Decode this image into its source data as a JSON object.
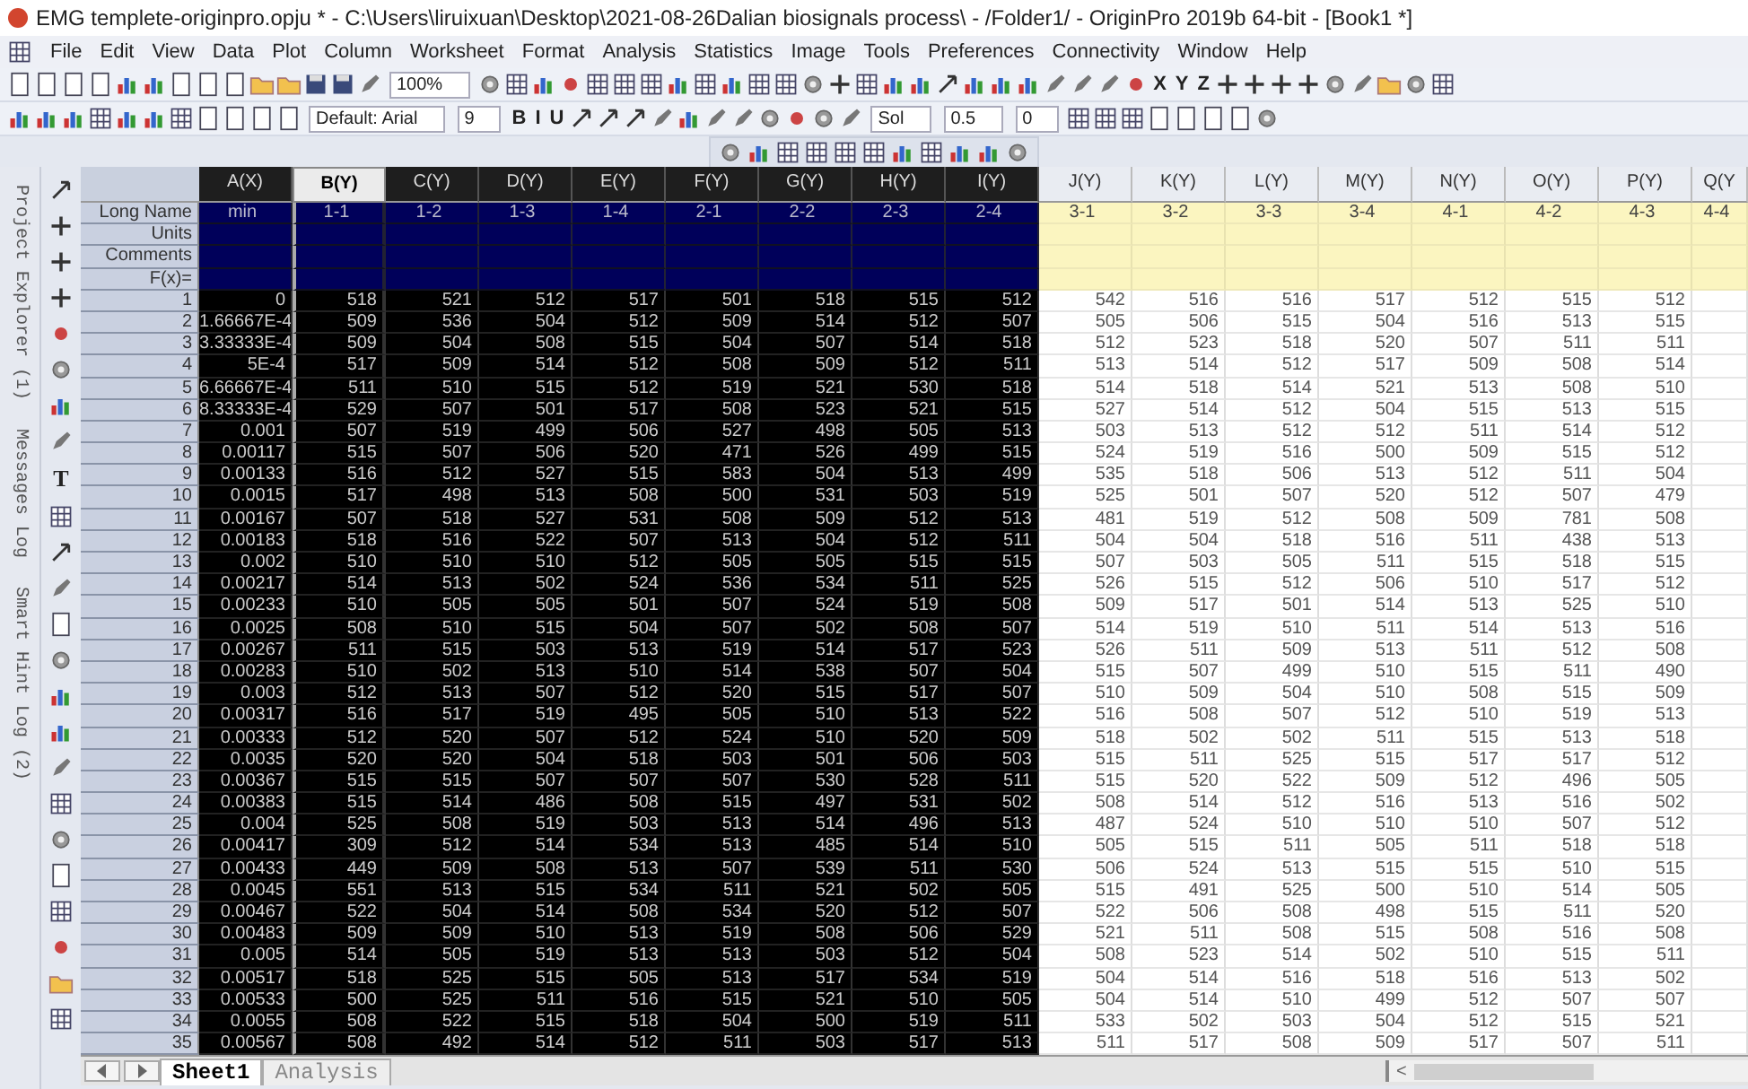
{
  "window": {
    "title": "EMG templete-originpro.opju * - C:\\Users\\liruixuan\\Desktop\\2021-08-26Dalian biosignals process\\ - /Folder1/ - OriginPro 2019b 64-bit - [Book1 *]"
  },
  "menu": [
    "File",
    "Edit",
    "View",
    "Data",
    "Plot",
    "Column",
    "Worksheet",
    "Format",
    "Analysis",
    "Statistics",
    "Image",
    "Tools",
    "Preferences",
    "Connectivity",
    "Window",
    "Help"
  ],
  "toolbar_1": [
    {
      "kind": "field",
      "value": "100%"
    },
    {
      "kind": "glyph",
      "text": "X"
    },
    {
      "kind": "glyph",
      "text": "Y"
    },
    {
      "kind": "glyph",
      "text": "Z"
    }
  ],
  "toolbar_2": [
    {
      "kind": "field",
      "value": "Default: Arial"
    },
    {
      "kind": "field",
      "value": "9"
    },
    {
      "kind": "glyph",
      "text": "B"
    },
    {
      "kind": "glyph",
      "text": "I"
    },
    {
      "kind": "glyph",
      "text": "U"
    },
    {
      "kind": "field",
      "value": "Sol"
    },
    {
      "kind": "field",
      "value": "0.5"
    },
    {
      "kind": "field",
      "value": "0"
    }
  ],
  "side_panels": [
    {
      "label": "Project Explorer (1)"
    },
    {
      "label": "Messages Log"
    },
    {
      "label": "Smart Hint Log (2)"
    }
  ],
  "tool_strip": {
    "text_tool": "T"
  },
  "meta_rows": [
    "Long Name",
    "Units",
    "Comments",
    "F(x)="
  ],
  "columns": [
    {
      "name": "A(X)",
      "long_name": "min",
      "selected": true,
      "current": false
    },
    {
      "name": "B(Y)",
      "long_name": "1-1",
      "selected": true,
      "current": true
    },
    {
      "name": "C(Y)",
      "long_name": "1-2",
      "selected": true,
      "current": false
    },
    {
      "name": "D(Y)",
      "long_name": "1-3",
      "selected": true,
      "current": false
    },
    {
      "name": "E(Y)",
      "long_name": "1-4",
      "selected": true,
      "current": false
    },
    {
      "name": "F(Y)",
      "long_name": "2-1",
      "selected": true,
      "current": false
    },
    {
      "name": "G(Y)",
      "long_name": "2-2",
      "selected": true,
      "current": false
    },
    {
      "name": "H(Y)",
      "long_name": "2-3",
      "selected": true,
      "current": false
    },
    {
      "name": "I(Y)",
      "long_name": "2-4",
      "selected": true,
      "current": false
    },
    {
      "name": "J(Y)",
      "long_name": "3-1",
      "selected": false,
      "current": false
    },
    {
      "name": "K(Y)",
      "long_name": "3-2",
      "selected": false,
      "current": false
    },
    {
      "name": "L(Y)",
      "long_name": "3-3",
      "selected": false,
      "current": false
    },
    {
      "name": "M(Y)",
      "long_name": "3-4",
      "selected": false,
      "current": false
    },
    {
      "name": "N(Y)",
      "long_name": "4-1",
      "selected": false,
      "current": false
    },
    {
      "name": "O(Y)",
      "long_name": "4-2",
      "selected": false,
      "current": false
    },
    {
      "name": "P(Y)",
      "long_name": "4-3",
      "selected": false,
      "current": false
    },
    {
      "name": "Q(Y",
      "long_name": "4-4",
      "selected": false,
      "current": false
    }
  ],
  "rows": [
    {
      "label": "1",
      "cells": [
        "0",
        "518",
        "521",
        "512",
        "517",
        "501",
        "518",
        "515",
        "512",
        "542",
        "516",
        "516",
        "517",
        "512",
        "515",
        "512"
      ]
    },
    {
      "label": "2",
      "cells": [
        "1.66667E-4",
        "509",
        "536",
        "504",
        "512",
        "509",
        "514",
        "512",
        "507",
        "505",
        "506",
        "515",
        "504",
        "516",
        "513",
        "515"
      ]
    },
    {
      "label": "3",
      "cells": [
        "3.33333E-4",
        "509",
        "504",
        "508",
        "515",
        "504",
        "507",
        "514",
        "518",
        "512",
        "523",
        "518",
        "520",
        "507",
        "511",
        "511"
      ]
    },
    {
      "label": "4",
      "cells": [
        "5E-4",
        "517",
        "509",
        "514",
        "512",
        "508",
        "509",
        "512",
        "511",
        "513",
        "514",
        "512",
        "517",
        "509",
        "508",
        "514"
      ]
    },
    {
      "label": "5",
      "cells": [
        "6.66667E-4",
        "511",
        "510",
        "515",
        "512",
        "519",
        "521",
        "530",
        "518",
        "514",
        "518",
        "514",
        "521",
        "513",
        "508",
        "510"
      ]
    },
    {
      "label": "6",
      "cells": [
        "8.33333E-4",
        "529",
        "507",
        "501",
        "517",
        "508",
        "523",
        "521",
        "515",
        "527",
        "514",
        "512",
        "504",
        "515",
        "513",
        "515"
      ]
    },
    {
      "label": "7",
      "cells": [
        "0.001",
        "507",
        "519",
        "499",
        "506",
        "527",
        "498",
        "505",
        "513",
        "503",
        "513",
        "512",
        "512",
        "511",
        "514",
        "512"
      ]
    },
    {
      "label": "8",
      "cells": [
        "0.00117",
        "515",
        "507",
        "506",
        "520",
        "471",
        "526",
        "499",
        "515",
        "524",
        "519",
        "516",
        "500",
        "509",
        "515",
        "512"
      ]
    },
    {
      "label": "9",
      "cells": [
        "0.00133",
        "516",
        "512",
        "527",
        "515",
        "583",
        "504",
        "513",
        "499",
        "535",
        "518",
        "506",
        "513",
        "512",
        "511",
        "504"
      ]
    },
    {
      "label": "10",
      "cells": [
        "0.0015",
        "517",
        "498",
        "513",
        "508",
        "500",
        "531",
        "503",
        "519",
        "525",
        "501",
        "507",
        "520",
        "512",
        "507",
        "479"
      ]
    },
    {
      "label": "11",
      "cells": [
        "0.00167",
        "507",
        "518",
        "527",
        "531",
        "508",
        "509",
        "512",
        "513",
        "481",
        "519",
        "512",
        "508",
        "509",
        "781",
        "508"
      ]
    },
    {
      "label": "12",
      "cells": [
        "0.00183",
        "518",
        "516",
        "522",
        "507",
        "513",
        "504",
        "512",
        "511",
        "504",
        "504",
        "518",
        "516",
        "511",
        "438",
        "513"
      ]
    },
    {
      "label": "13",
      "cells": [
        "0.002",
        "510",
        "510",
        "510",
        "512",
        "505",
        "505",
        "515",
        "515",
        "507",
        "503",
        "505",
        "511",
        "515",
        "518",
        "515"
      ]
    },
    {
      "label": "14",
      "cells": [
        "0.00217",
        "514",
        "513",
        "502",
        "524",
        "536",
        "534",
        "511",
        "525",
        "526",
        "515",
        "512",
        "506",
        "510",
        "517",
        "512"
      ]
    },
    {
      "label": "15",
      "cells": [
        "0.00233",
        "510",
        "505",
        "505",
        "501",
        "507",
        "524",
        "519",
        "508",
        "509",
        "517",
        "501",
        "514",
        "513",
        "525",
        "510"
      ]
    },
    {
      "label": "16",
      "cells": [
        "0.0025",
        "508",
        "510",
        "515",
        "504",
        "507",
        "502",
        "508",
        "507",
        "514",
        "519",
        "510",
        "511",
        "514",
        "513",
        "516"
      ]
    },
    {
      "label": "17",
      "cells": [
        "0.00267",
        "511",
        "515",
        "503",
        "513",
        "519",
        "514",
        "517",
        "523",
        "526",
        "511",
        "509",
        "513",
        "511",
        "512",
        "508"
      ]
    },
    {
      "label": "18",
      "cells": [
        "0.00283",
        "510",
        "502",
        "513",
        "510",
        "514",
        "538",
        "507",
        "504",
        "515",
        "507",
        "499",
        "510",
        "515",
        "511",
        "490"
      ]
    },
    {
      "label": "19",
      "cells": [
        "0.003",
        "512",
        "513",
        "507",
        "512",
        "520",
        "515",
        "517",
        "507",
        "510",
        "509",
        "504",
        "510",
        "508",
        "515",
        "509"
      ]
    },
    {
      "label": "20",
      "cells": [
        "0.00317",
        "516",
        "517",
        "519",
        "495",
        "505",
        "510",
        "513",
        "522",
        "516",
        "508",
        "507",
        "512",
        "510",
        "519",
        "513"
      ]
    },
    {
      "label": "21",
      "cells": [
        "0.00333",
        "512",
        "520",
        "507",
        "512",
        "524",
        "510",
        "520",
        "509",
        "518",
        "502",
        "502",
        "511",
        "515",
        "513",
        "518"
      ]
    },
    {
      "label": "22",
      "cells": [
        "0.0035",
        "520",
        "520",
        "504",
        "518",
        "503",
        "501",
        "506",
        "503",
        "515",
        "511",
        "525",
        "515",
        "517",
        "517",
        "512"
      ]
    },
    {
      "label": "23",
      "cells": [
        "0.00367",
        "515",
        "515",
        "507",
        "507",
        "507",
        "530",
        "528",
        "511",
        "515",
        "520",
        "522",
        "509",
        "512",
        "496",
        "505"
      ]
    },
    {
      "label": "24",
      "cells": [
        "0.00383",
        "515",
        "514",
        "486",
        "508",
        "515",
        "497",
        "531",
        "502",
        "508",
        "514",
        "512",
        "516",
        "513",
        "516",
        "502"
      ]
    },
    {
      "label": "25",
      "cells": [
        "0.004",
        "525",
        "508",
        "519",
        "503",
        "513",
        "514",
        "496",
        "513",
        "487",
        "524",
        "510",
        "510",
        "510",
        "507",
        "512"
      ]
    },
    {
      "label": "26",
      "cells": [
        "0.00417",
        "309",
        "512",
        "514",
        "534",
        "513",
        "485",
        "514",
        "510",
        "505",
        "515",
        "511",
        "505",
        "511",
        "518",
        "518"
      ]
    },
    {
      "label": "27",
      "cells": [
        "0.00433",
        "449",
        "509",
        "508",
        "513",
        "507",
        "539",
        "511",
        "530",
        "506",
        "524",
        "513",
        "515",
        "515",
        "510",
        "515"
      ]
    },
    {
      "label": "28",
      "cells": [
        "0.0045",
        "551",
        "513",
        "515",
        "534",
        "511",
        "521",
        "502",
        "505",
        "515",
        "491",
        "525",
        "500",
        "510",
        "514",
        "505"
      ]
    },
    {
      "label": "29",
      "cells": [
        "0.00467",
        "522",
        "504",
        "514",
        "508",
        "534",
        "520",
        "512",
        "507",
        "522",
        "506",
        "508",
        "498",
        "515",
        "511",
        "520"
      ]
    },
    {
      "label": "30",
      "cells": [
        "0.00483",
        "509",
        "509",
        "510",
        "513",
        "519",
        "508",
        "506",
        "529",
        "521",
        "511",
        "508",
        "515",
        "508",
        "516",
        "508"
      ]
    },
    {
      "label": "31",
      "cells": [
        "0.005",
        "514",
        "505",
        "519",
        "513",
        "513",
        "503",
        "512",
        "504",
        "508",
        "523",
        "514",
        "502",
        "510",
        "515",
        "511"
      ]
    },
    {
      "label": "32",
      "cells": [
        "0.00517",
        "518",
        "525",
        "515",
        "505",
        "513",
        "517",
        "534",
        "519",
        "504",
        "514",
        "516",
        "518",
        "516",
        "513",
        "502"
      ]
    },
    {
      "label": "33",
      "cells": [
        "0.00533",
        "500",
        "525",
        "511",
        "516",
        "515",
        "521",
        "510",
        "505",
        "504",
        "514",
        "510",
        "499",
        "512",
        "507",
        "507"
      ]
    },
    {
      "label": "34",
      "cells": [
        "0.0055",
        "508",
        "522",
        "515",
        "518",
        "504",
        "500",
        "519",
        "511",
        "533",
        "502",
        "503",
        "504",
        "512",
        "515",
        "521"
      ]
    },
    {
      "label": "35",
      "cells": [
        "0.00567",
        "508",
        "492",
        "514",
        "512",
        "511",
        "503",
        "517",
        "513",
        "511",
        "517",
        "508",
        "509",
        "517",
        "507",
        "511"
      ]
    }
  ],
  "sheet_tabs": [
    {
      "label": "Sheet1",
      "selected": true
    },
    {
      "label": "Analysis",
      "selected": false
    }
  ],
  "scroll_arrow": "<"
}
